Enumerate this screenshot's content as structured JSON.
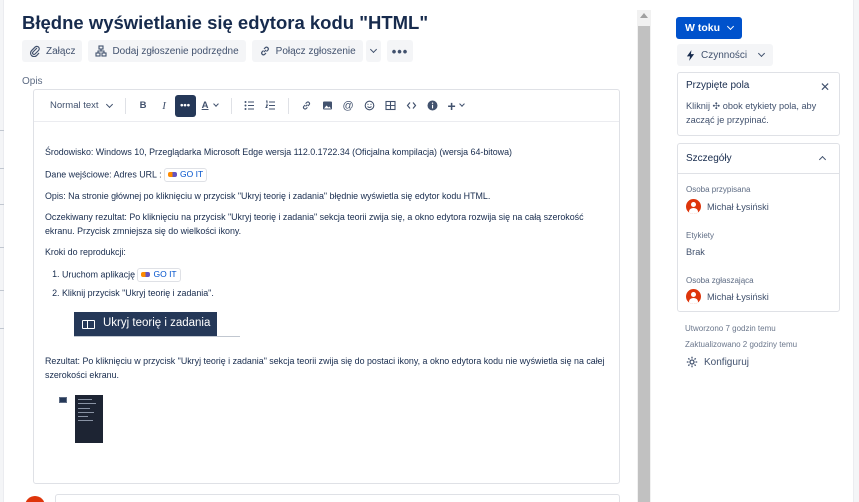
{
  "issue": {
    "title": "Błędne wyświetlanie się edytora kodu \"HTML\""
  },
  "actions": {
    "attach": "Załącz",
    "add_child": "Dodaj zgłoszenie podrzędne",
    "link_issue": "Połącz zgłoszenie"
  },
  "description": {
    "label": "Opis",
    "toolbar": {
      "text_style": "Normal text"
    },
    "env_line": "Środowisko: Windows 10, Przeglądarka Microsoft Edge wersja 112.0.1722.34 (Oficjalna kompilacja) (wersja 64-bitowa)",
    "input_prefix": "Dane wejściowe: Adres URL : ",
    "link_chip": "GO IT",
    "op_line": "Opis: Na stronie głównej po kliknięciu w przycisk \"Ukryj teorię i zadania\" błędnie wyświetla się edytor kodu HTML.",
    "expected_line": "Oczekiwany rezultat: Po kliknięciu na przycisk \"Ukryj teorię i zadania\" sekcja teorii zwija się, a okno edytora rozwija się na całą szerokość ekranu. Przycisk zmniejsza się do wielkości ikony.",
    "steps_title": "Kroki do reprodukcji:",
    "step1_prefix": "Uruchom aplikację",
    "step1_chip": "GO IT",
    "step2": "Kliknij przycisk \"Ukryj teorię i zadania\".",
    "hide_button_image_text": "Ukryj teorię i zadania",
    "result_line": "Rezultat: Po kliknięciu w przycisk  \"Ukryj teorię i zadania\" sekcja teorii zwija się do postaci ikony, a okno edytora kodu nie wyświetla się na całej szerokości ekranu."
  },
  "sidebar": {
    "status": "W toku",
    "actions_label": "Czynności",
    "pinned": {
      "title": "Przypięte pola",
      "text": "Kliknij ✣ obok etykiety pola, aby zacząć je przypinać."
    },
    "details": {
      "title": "Szczegóły",
      "assignee_label": "Osoba przypisana",
      "assignee": "Michał Łysiński",
      "labels_label": "Etykiety",
      "labels_value": "Brak",
      "reporter_label": "Osoba zgłaszająca",
      "reporter": "Michał Łysiński"
    },
    "created": "Utworzono 7 godzin temu",
    "updated": "Zaktualizowano 2 godziny temu",
    "configure": "Konfiguruj"
  },
  "colors": {
    "primary": "#0052cc",
    "dark_navy": "#253858",
    "avatar": "#de350b"
  }
}
